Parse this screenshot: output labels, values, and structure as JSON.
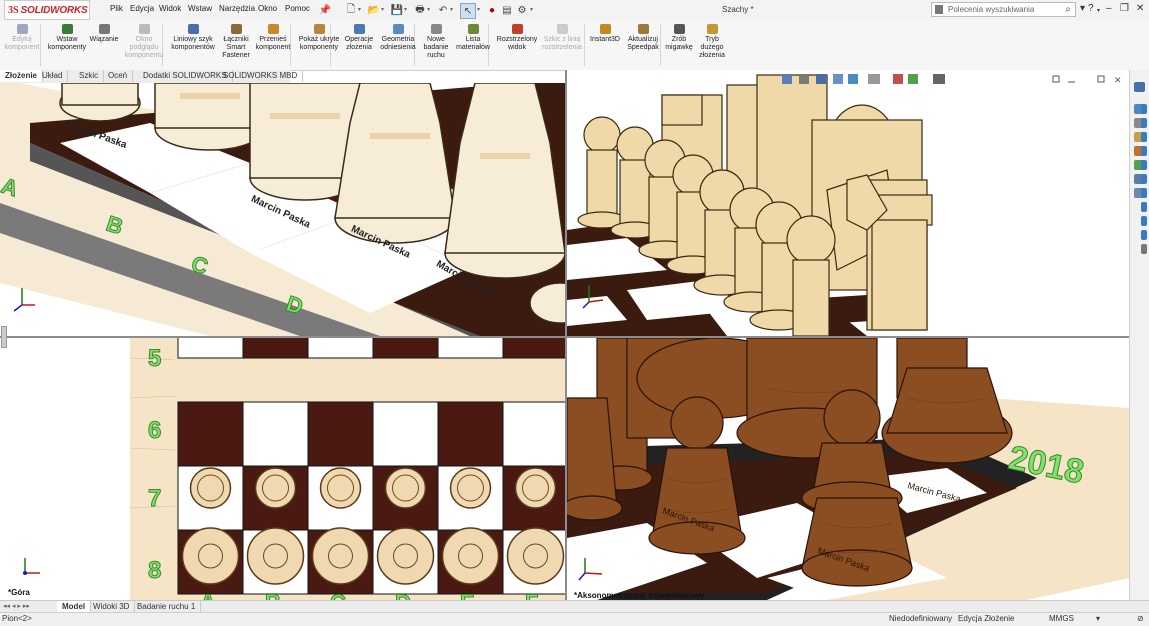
{
  "app": {
    "logo_ds": "3S",
    "logo_name": "SOLIDWORKS",
    "document_title": "Szachy *"
  },
  "menu": [
    "Plik",
    "Edycja",
    "Widok",
    "Wstaw",
    "Narzędzia",
    "Okno",
    "Pomoc"
  ],
  "search": {
    "placeholder": "Polecenia wyszukiwania"
  },
  "window_controls": {
    "help": "?",
    "minimize": "–",
    "restore": "❐",
    "close": "✕"
  },
  "ribbon": [
    {
      "label": "Edytuj\nkomponent",
      "disabled": true,
      "color": "#9ab"
    },
    {
      "label": "Wstaw\nkomponenty",
      "disabled": false,
      "color": "#3a7a3a"
    },
    {
      "label": "Wiązanie",
      "disabled": false,
      "color": "#777"
    },
    {
      "label": "Okno\npodglądu\nkomponentu",
      "disabled": true,
      "color": "#bbb"
    },
    {
      "label": "Liniowy szyk\nkomponentów",
      "disabled": false,
      "color": "#4a6fa8"
    },
    {
      "label": "Łączniki\nSmart\nFastener",
      "disabled": false,
      "color": "#8a6a3a"
    },
    {
      "label": "Przenieś\nkomponent",
      "disabled": false,
      "color": "#c78a2a"
    },
    {
      "label": "Pokaż ukryte\nkomponenty",
      "disabled": false,
      "color": "#b8863a"
    },
    {
      "label": "Operacje\nzłożenia",
      "disabled": false,
      "color": "#4a7ab0"
    },
    {
      "label": "Geometria\nodniesienia",
      "disabled": false,
      "color": "#5a8ac0"
    },
    {
      "label": "Nowe\nbadanie\nruchu",
      "disabled": false,
      "color": "#888"
    },
    {
      "label": "Lista\nmateriałów",
      "disabled": false,
      "color": "#6a8a3a"
    },
    {
      "label": "Rozstrzelony\nwidok",
      "disabled": false,
      "color": "#c0402a"
    },
    {
      "label": "Szkic z linią\nrozstrzelenia",
      "disabled": true,
      "color": "#ccc"
    },
    {
      "label": "Instant3D",
      "disabled": false,
      "color": "#c08a20"
    },
    {
      "label": "Aktualizuj\nSpeedpak",
      "disabled": false,
      "color": "#9a7a3a"
    },
    {
      "label": "Zrób\nmigawkę",
      "disabled": false,
      "color": "#555"
    },
    {
      "label": "Tryb\ndużego\nzłożenia",
      "disabled": false,
      "color": "#c09a30"
    }
  ],
  "command_tabs": [
    "Złożenie",
    "Układ",
    "Szkic",
    "Oceń",
    "Dodatki SOLIDWORKS",
    "SOLIDWORKS MBD"
  ],
  "viewports": {
    "top_left": {
      "label": ""
    },
    "top_right": {
      "label": ""
    },
    "bottom_left": {
      "label": "*Góra",
      "ranks": [
        "5",
        "6",
        "7",
        "8"
      ],
      "files": [
        "A",
        "B",
        "C",
        "D",
        "E",
        "F"
      ]
    },
    "bottom_right": {
      "label": "*Aksonometryczny trójwymiarowy",
      "year_fragment": "2018"
    },
    "engraving": "Marcin Paska",
    "board_letters": [
      "A",
      "B",
      "C",
      "D"
    ]
  },
  "bottom_tabs": [
    "Model",
    "Widoki 3D",
    "Badanie ruchu 1"
  ],
  "status": {
    "left": "Pion<2>",
    "definition": "Niedodefiniowany",
    "mode": "Edycja Złożenie",
    "units": "MMGS",
    "units_caret": "▾"
  },
  "colors": {
    "light_wood": "#f0d9b0",
    "dark_wood": "#8a4a20",
    "board_dark": "#4a1a12",
    "board_light": "#ffffff",
    "label_green": "#7fe26a",
    "accent_red": "#d0202a"
  }
}
